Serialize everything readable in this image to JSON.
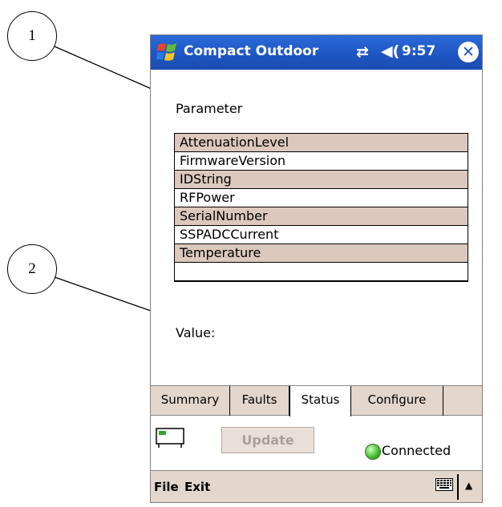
{
  "callouts": [
    "1",
    "2"
  ],
  "titlebar": {
    "app_title": "Compact Outdoor",
    "clock": "9:57",
    "start_icon": "windows-flag-icon",
    "connectivity_icon": "connectivity-arrows-icon",
    "volume_icon": "speaker-icon",
    "close_icon": "close-icon"
  },
  "parameter_label": "Parameter",
  "parameters": [
    "AttenuationLevel",
    "FirmwareVersion",
    "IDString",
    "RFPower",
    "SerialNumber",
    "SSPADCCurrent",
    "Temperature",
    ""
  ],
  "value_label": "Value:",
  "tabs": [
    "Summary",
    "Faults",
    "Status",
    "Configure"
  ],
  "active_tab": "Status",
  "update_label": "Update",
  "status_text": "Connected",
  "menu": [
    "File",
    "Exit"
  ],
  "colors": {
    "titlebar": "#1e55c2",
    "row_shade": "#dcc8bd",
    "status_ok": "#45c12f",
    "chrome": "#e3d6cc"
  }
}
